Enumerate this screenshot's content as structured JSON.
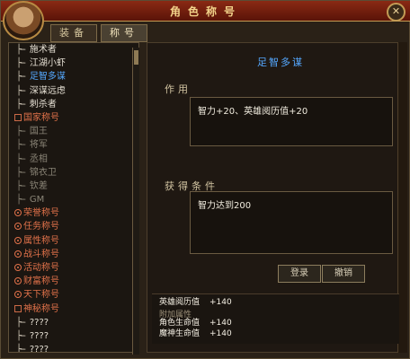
{
  "window": {
    "title": "角色称号",
    "close_label": "✕"
  },
  "tabs": [
    {
      "label": "装备"
    },
    {
      "label": "称号"
    }
  ],
  "tree": [
    {
      "type": "sub",
      "label": "施术者"
    },
    {
      "type": "sub",
      "label": "江湖小虾"
    },
    {
      "type": "sub-selected",
      "label": "足智多谋"
    },
    {
      "type": "sub",
      "label": "深谋远虑"
    },
    {
      "type": "sub",
      "label": "刺杀者"
    },
    {
      "type": "category",
      "label": "国家称号"
    },
    {
      "type": "sub-disabled",
      "label": "国王"
    },
    {
      "type": "sub-disabled",
      "label": "将军"
    },
    {
      "type": "sub-disabled",
      "label": "丞相"
    },
    {
      "type": "sub-disabled",
      "label": "锦衣卫"
    },
    {
      "type": "sub-disabled",
      "label": "钦差"
    },
    {
      "type": "sub-disabled",
      "label": "GM"
    },
    {
      "type": "radio",
      "label": "荣誉称号"
    },
    {
      "type": "radio",
      "label": "任务称号"
    },
    {
      "type": "radio",
      "label": "属性称号"
    },
    {
      "type": "radio",
      "label": "战斗称号"
    },
    {
      "type": "radio",
      "label": "活动称号"
    },
    {
      "type": "radio",
      "label": "财富称号"
    },
    {
      "type": "radio",
      "label": "天下称号"
    },
    {
      "type": "category",
      "label": "神秘称号"
    },
    {
      "type": "sub",
      "label": "????"
    },
    {
      "type": "sub",
      "label": "????"
    },
    {
      "type": "sub",
      "label": "????"
    }
  ],
  "detail": {
    "title": "足智多谋",
    "effect_label": "作用",
    "effect_text": "智力+20、英雄阅历值+20",
    "condition_label": "获得条件",
    "condition_text": "智力达到200",
    "confirm_label": "登录",
    "cancel_label": "撤销"
  },
  "stats": {
    "line1_label": "英雄阅历值",
    "line1_value": "+140",
    "extra_label": "附加属性",
    "line2_label": "角色生命值",
    "line2_value": "+140",
    "line3_label": "魔神生命值",
    "line3_value": "+140"
  }
}
